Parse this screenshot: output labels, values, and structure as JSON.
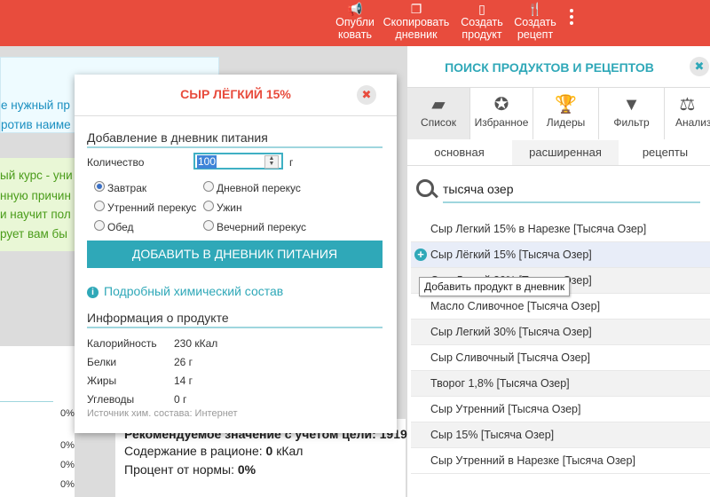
{
  "toolbar": {
    "publish": "Опубли ковать",
    "publish_l1": "Опубли",
    "publish_l2": "ковать",
    "copy_l1": "Скопировать",
    "copy_l2": "дневник",
    "create_product_l1": "Создать",
    "create_product_l2": "продукт",
    "create_recipe_l1": "Создать",
    "create_recipe_l2": "рецепт"
  },
  "background": {
    "info_lines": [
      "е нужный пр",
      "ротив наиме"
    ],
    "green_lines": [
      "ый курс - уни",
      "нную причин",
      "и научит пол",
      "рует вам бы"
    ],
    "percents": [
      "0%",
      "0%",
      "0%",
      "0%"
    ],
    "cut_line": "Рекомендуемое значение с учетом цели: 1919",
    "diet_label": "Содержание в рационе:",
    "diet_value": "0",
    "diet_unit": "кКал",
    "norm_label": "Процент от нормы:",
    "norm_value": "0%"
  },
  "modal": {
    "title": "СЫР ЛЁГКИЙ 15%",
    "close": "✖",
    "diary_heading": "Добавление в дневник питания",
    "quantity_label": "Количество",
    "quantity_value": "100",
    "quantity_unit": "г",
    "meals": [
      {
        "label": "Завтрак",
        "selected": true
      },
      {
        "label": "Дневной перекус",
        "selected": false
      },
      {
        "label": "Утренний перекус",
        "selected": false
      },
      {
        "label": "Ужин",
        "selected": false
      },
      {
        "label": "Обед",
        "selected": false
      },
      {
        "label": "Вечерний перекус",
        "selected": false
      }
    ],
    "add_button": "ДОБАВИТЬ В ДНЕВНИК ПИТАНИЯ",
    "chem_link": "Подробный химический состав",
    "info_heading": "Информация о продукте",
    "nutrients": [
      {
        "name": "Калорийность",
        "value": "230 кКал"
      },
      {
        "name": "Белки",
        "value": "26 г"
      },
      {
        "name": "Жиры",
        "value": "14 г"
      },
      {
        "name": "Углеводы",
        "value": "0 г"
      }
    ],
    "source": "Источник хим. состава: Интернет"
  },
  "search_panel": {
    "title": "ПОИСК ПРОДУКТОВ И РЕЦЕПТОВ",
    "categories": [
      "Список",
      "Избранное",
      "Лидеры",
      "Фильтр",
      "Анализ"
    ],
    "subtabs": [
      "основная",
      "расширенная",
      "рецепты"
    ],
    "query": "тысяча озер",
    "results": [
      "Сыр Легкий 15% в Нарезке [Тысяча Озер]",
      "Сыр Лёгкий 15% [Тысяча Озер]",
      "Сыр Легкий 30% [Тысяча Озер]",
      "Масло Сливочное [Тысяча Озер]",
      "Сыр Легкий 30% [Тысяча Озер]",
      "Сыр Сливочный [Тысяча Озер]",
      "Творог 1,8% [Тысяча Озер]",
      "Сыр Утренний [Тысяча Озер]",
      "Сыр 15% [Тысяча Озер]",
      "Сыр Утренний в Нарезке [Тысяча Озер]"
    ],
    "tooltip": "Добавить продукт в дневник"
  }
}
